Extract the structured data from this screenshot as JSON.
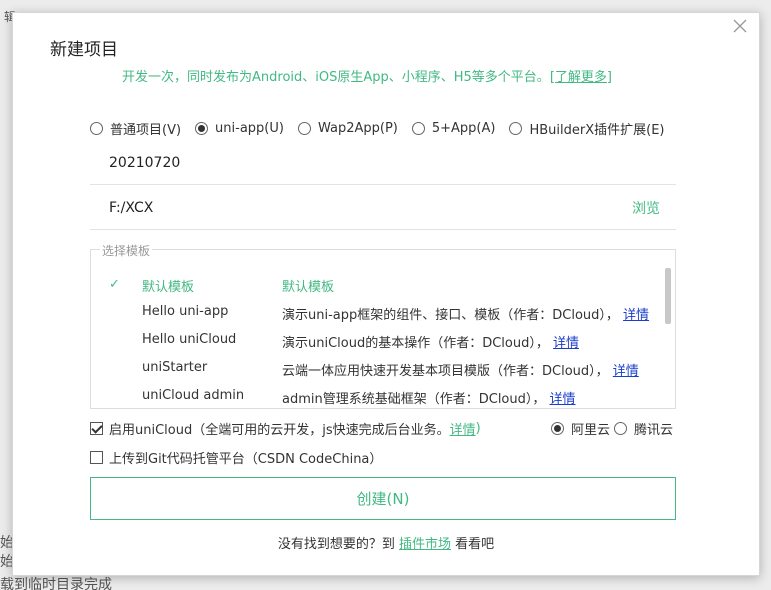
{
  "background": {
    "frag_top": "辑",
    "frag_left1": "始",
    "frag_left2": "始",
    "frag_bottom": "载到临时目录完成"
  },
  "dialog": {
    "title": "新建项目",
    "subtitle_text": "开发一次，同时发布为Android、iOS原生App、小程序、H5等多个平台。",
    "subtitle_link": "[了解更多]"
  },
  "project_types": [
    {
      "label": "普通项目(V)",
      "checked": false
    },
    {
      "label": "uni-app(U)",
      "checked": true
    },
    {
      "label": "Wap2App(P)",
      "checked": false
    },
    {
      "label": "5+App(A)",
      "checked": false
    },
    {
      "label": "HBuilderX插件扩展(E)",
      "checked": false
    }
  ],
  "project_name": "20210720",
  "project_path": "F:/XCX",
  "browse_label": "浏览",
  "template": {
    "legend": "选择模板",
    "rows": [
      {
        "name": "默认模板",
        "desc": "默认模板",
        "more": "",
        "selected": true
      },
      {
        "name": "Hello uni-app",
        "desc": "演示uni-app框架的组件、接口、模板（作者：DCloud），",
        "more": "详情",
        "selected": false
      },
      {
        "name": "Hello uniCloud",
        "desc": "演示uniCloud的基本操作（作者：DCloud），",
        "more": "详情",
        "selected": false
      },
      {
        "name": "uniStarter",
        "desc": "云端一体应用快速开发基本项目模版（作者：DCloud），",
        "more": "详情",
        "selected": false
      },
      {
        "name": "uniCloud admin",
        "desc": "admin管理系统基础框架（作者：DCloud），",
        "more": "详情",
        "selected": false
      }
    ]
  },
  "unicloud": {
    "label": "启用uniCloud（全端可用的云开发，js快速完成后台业务。",
    "link": "详情",
    "suffix": ")",
    "checked": true,
    "providers": [
      {
        "label": "阿里云",
        "checked": true
      },
      {
        "label": "腾讯云",
        "checked": false
      }
    ]
  },
  "git": {
    "label": "上传到Git代码托管平台（CSDN CodeChina）",
    "checked": false
  },
  "create_label": "创建(N)",
  "footer": {
    "prefix": "没有找到想要的？到",
    "link": "插件市场",
    "suffix": "看看吧"
  },
  "colors": {
    "accent": "#42b983",
    "link_blue": "#1a3ecc"
  }
}
